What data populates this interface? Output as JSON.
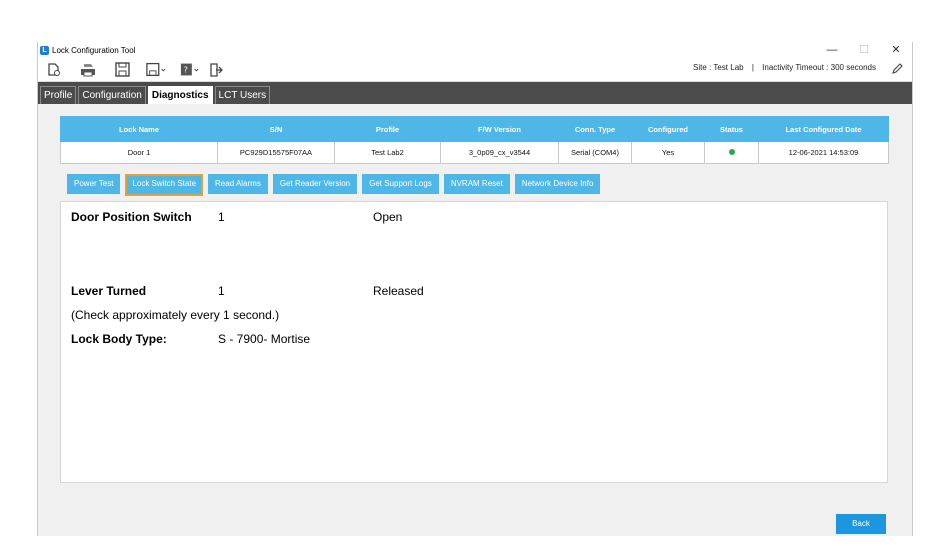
{
  "window": {
    "title": "Lock Configuration Tool",
    "minimize": "—",
    "maximize": "☐",
    "close": "✕"
  },
  "toolbar": {
    "site_label": "Site :",
    "site_value": "Test Lab",
    "separator": "|",
    "timeout_label": "Inactivity Timeout :",
    "timeout_value": "300 seconds",
    "icons": [
      "new-file-icon",
      "print-icon",
      "save-icon",
      "save-as-icon",
      "help-icon",
      "exit-icon",
      "edit-pencil-icon"
    ]
  },
  "tabs": [
    {
      "label": "Profile"
    },
    {
      "label": "Configuration"
    },
    {
      "label": "Diagnostics",
      "active": true
    },
    {
      "label": "LCT Users"
    }
  ],
  "lock_table": {
    "headers": [
      "Lock Name",
      "S/N",
      "Profile",
      "F/W Version",
      "Conn. Type",
      "Configured",
      "Status",
      "Last Configured Date"
    ],
    "rows": [
      {
        "lock_name": "Door 1",
        "sn": "PC929D15575F07AA",
        "profile": "Test Lab2",
        "fw_version": "3_0p09_cx_v3544",
        "conn_type": "Serial (COM4)",
        "configured": "Yes",
        "status_color": "#2ea84a",
        "last_configured": "12-06-2021 14:53:09"
      }
    ]
  },
  "actions": [
    {
      "label": "Power Test"
    },
    {
      "label": "Lock Switch State",
      "active": true
    },
    {
      "label": "Read Alarms"
    },
    {
      "label": "Get Reader Version"
    },
    {
      "label": "Get Support Logs"
    },
    {
      "label": "NVRAM Reset"
    },
    {
      "label": "Network Device Info"
    }
  ],
  "diagnostics": {
    "door_position": {
      "label": "Door Position Switch",
      "value": "1",
      "state": "Open"
    },
    "lever": {
      "label": "Lever Turned",
      "value": "1",
      "state": "Released"
    },
    "note": "(Check approximately every 1 second.)",
    "body_type": {
      "label": "Lock Body Type:",
      "value": "S - 7900- Mortise"
    }
  },
  "back_label": "Back",
  "colors": {
    "accent": "#4fb7e7",
    "tab_bar": "#4b4b4b",
    "active_border": "#e0a435",
    "back_button": "#1c96de"
  }
}
